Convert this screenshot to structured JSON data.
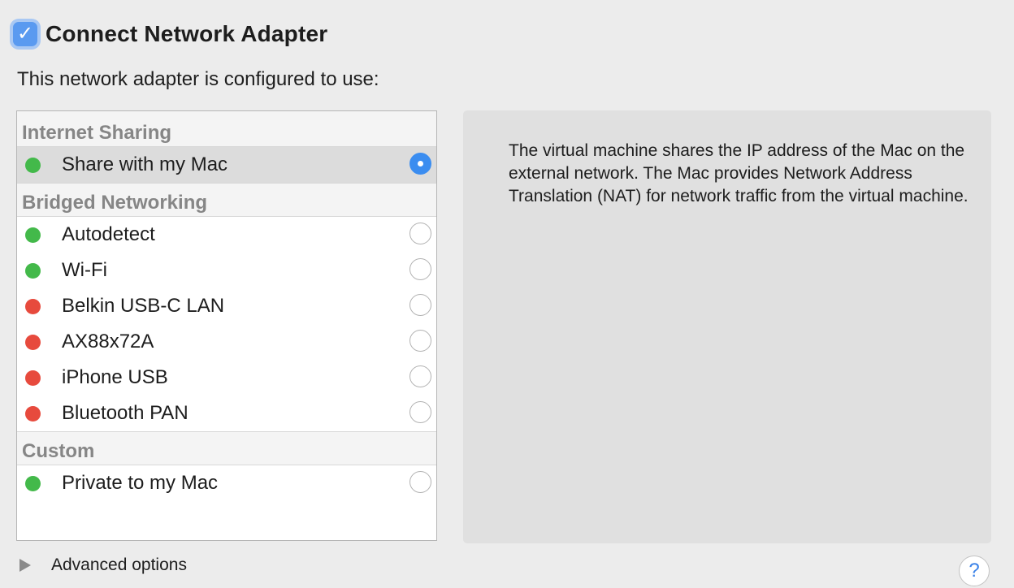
{
  "header": {
    "checkbox_checked": true,
    "checkmark_glyph": "✓",
    "title": "Connect Network Adapter"
  },
  "subtitle": "This network adapter is configured to use:",
  "groups": [
    {
      "label": "Internet Sharing",
      "items": [
        {
          "label": "Share with my Mac",
          "status": "green",
          "selected": true
        }
      ]
    },
    {
      "label": "Bridged Networking",
      "items": [
        {
          "label": "Autodetect",
          "status": "green",
          "selected": false
        },
        {
          "label": "Wi-Fi",
          "status": "green",
          "selected": false
        },
        {
          "label": "Belkin USB-C LAN",
          "status": "red",
          "selected": false
        },
        {
          "label": "AX88x72A",
          "status": "red",
          "selected": false
        },
        {
          "label": "iPhone USB",
          "status": "red",
          "selected": false
        },
        {
          "label": "Bluetooth PAN",
          "status": "red",
          "selected": false
        }
      ]
    },
    {
      "label": "Custom",
      "items": [
        {
          "label": "Private to my Mac",
          "status": "green",
          "selected": false
        }
      ]
    }
  ],
  "description": "The virtual machine shares the IP address of the Mac on the external network. The Mac provides Network Address Translation (NAT) for network traffic from the virtual machine.",
  "advanced_label": "Advanced options",
  "help_glyph": "?",
  "colors": {
    "accent": "#3b8df0",
    "status_green": "#43b94a",
    "status_red": "#e74a3d"
  }
}
